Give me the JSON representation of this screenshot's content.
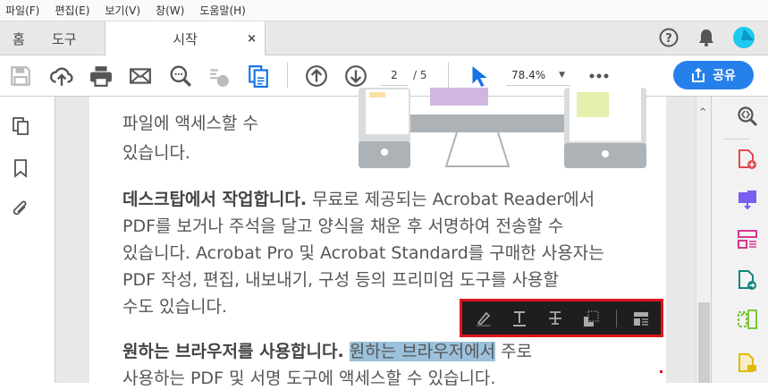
{
  "menu": [
    "파일(F)",
    "편집(E)",
    "보기(V)",
    "창(W)",
    "도움말(H)"
  ],
  "tabs": {
    "home": "홈",
    "tools": "도구",
    "document": "시작",
    "close": "×"
  },
  "toolbar": {
    "page_current": "2",
    "page_total": "/ 5",
    "zoom": "78.4%",
    "share_label": "공유"
  },
  "document": {
    "lines": [
      "파일에 액세스할 수",
      "있습니다.",
      "무료로 제공되는 Acrobat Reader에서",
      "PDF를 보거나 주석을 달고 양식을 채운 후 서명하여 전송할 수",
      "있습니다. Acrobat Pro 및 Acrobat Standard를 구매한 사용자는",
      "PDF 작성, 편집, 내보내기, 구성 등의 프리미엄 도구를 사용할",
      "수도 있습니다.",
      "주로",
      "사용하는 PDF 및 서명 도구에 액세스할 수 있습니다."
    ],
    "heading1": "데스크탑에서 작업합니다.",
    "heading2": "원하는 브라우저를 사용합니다.",
    "highlighted": "원하는 브라우저에서"
  },
  "colors": {
    "accent": "#2680eb",
    "highlight": "#9cc1dc",
    "selection_border": "#e0141e"
  }
}
